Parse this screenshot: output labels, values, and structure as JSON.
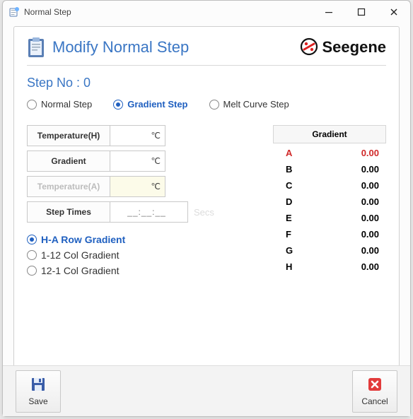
{
  "window": {
    "title": "Normal Step"
  },
  "panel": {
    "title": "Modify Normal Step"
  },
  "brand": {
    "name": "Seegene"
  },
  "step": {
    "label": "Step No : 0"
  },
  "step_types": {
    "normal": "Normal Step",
    "gradient": "Gradient Step",
    "melt": "Melt Curve Step"
  },
  "fields": {
    "temp_h_label": "Temperature(H)",
    "temp_h_unit": "℃",
    "gradient_label": "Gradient",
    "gradient_unit": "℃",
    "temp_a_label": "Temperature(A)",
    "temp_a_unit": "℃",
    "step_times_label": "Step Times",
    "step_times_value": "__:__:__",
    "secs": "Secs"
  },
  "gradient_modes": {
    "ha": "H-A Row Gradient",
    "c112": "1-12 Col Gradient",
    "c121": "12-1 Col Gradient"
  },
  "gradient_table": {
    "header": "Gradient",
    "rows": [
      {
        "label": "A",
        "value": "0.00",
        "hot": true
      },
      {
        "label": "B",
        "value": "0.00"
      },
      {
        "label": "C",
        "value": "0.00"
      },
      {
        "label": "D",
        "value": "0.00"
      },
      {
        "label": "E",
        "value": "0.00"
      },
      {
        "label": "F",
        "value": "0.00"
      },
      {
        "label": "G",
        "value": "0.00"
      },
      {
        "label": "H",
        "value": "0.00"
      }
    ]
  },
  "buttons": {
    "save": "Save",
    "cancel": "Cancel"
  }
}
